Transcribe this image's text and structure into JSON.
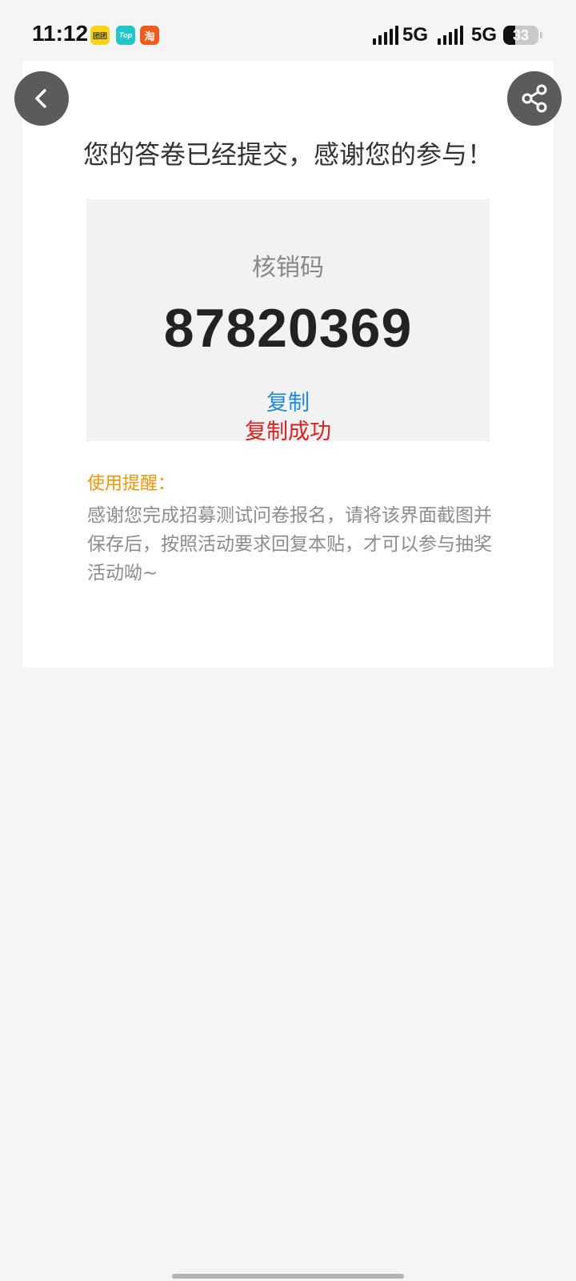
{
  "status_bar": {
    "time": "11:12",
    "apps": [
      {
        "name": "meituan-style-app-icon",
        "glyph": "团团"
      },
      {
        "name": "top-app-icon",
        "glyph": "Top"
      },
      {
        "name": "taobao-app-icon",
        "glyph": "淘"
      }
    ],
    "network_1": "5G",
    "network_2": "5G",
    "battery_level": "33",
    "battery_fraction": 0.33
  },
  "nav": {
    "back_icon": "chevron-left-icon",
    "share_icon": "share-icon"
  },
  "main": {
    "headline": "您的答卷已经提交，感谢您的参与！",
    "code_label": "核销码",
    "code_value": "87820369",
    "copy_label": "复制",
    "copy_success": "复制成功",
    "tip_title": "使用提醒：",
    "tip_body": "感谢您完成招募测试问卷报名，请将该界面截图并保存后，按照活动要求回复本贴，才可以参与抽奖活动呦~"
  },
  "colors": {
    "accent_blue": "#1f8ae0",
    "success_red": "#e02020",
    "tip_orange": "#f0950a",
    "button_gray": "#5b5b5b"
  }
}
